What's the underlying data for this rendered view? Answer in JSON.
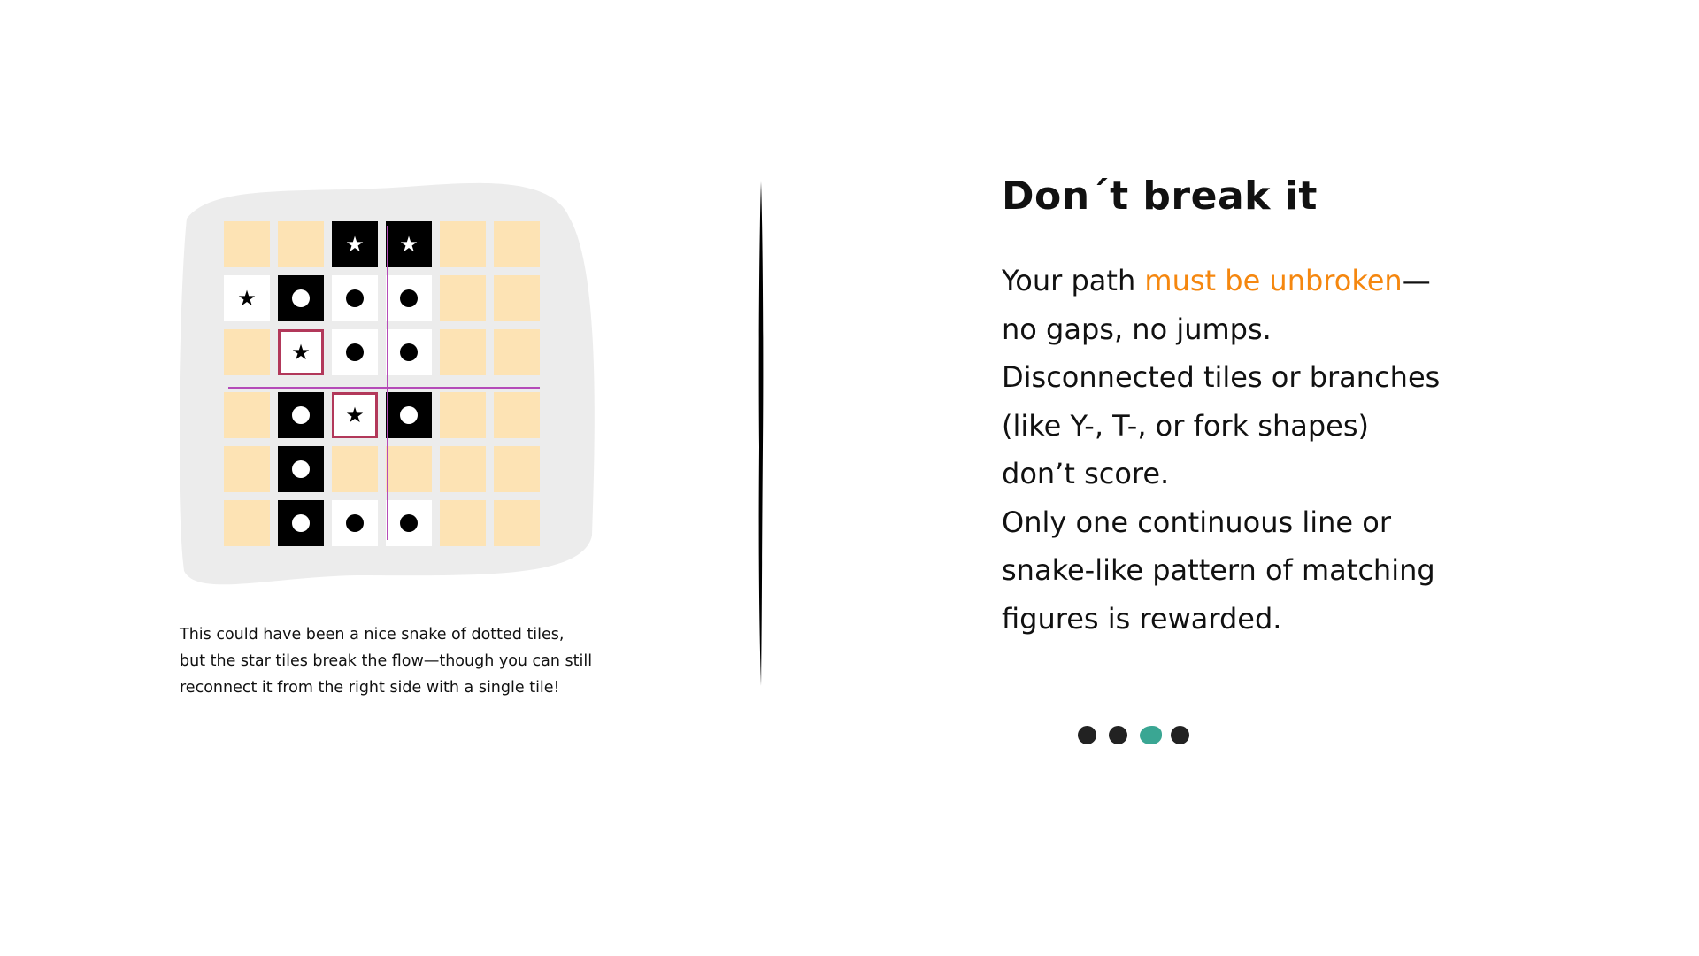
{
  "illustration": {
    "grid": [
      [
        "empty",
        "empty",
        "dark-star",
        "dark-star",
        "empty",
        "empty"
      ],
      [
        "light-star",
        "dark-dot",
        "light-dot",
        "light-dot",
        "empty",
        "empty"
      ],
      [
        "empty",
        "outlined-star",
        "light-dot",
        "light-dot",
        "empty",
        "empty"
      ],
      [
        "empty",
        "dark-dot",
        "outlined-star",
        "dark-dot",
        "empty",
        "empty"
      ],
      [
        "empty",
        "dark-dot",
        "empty",
        "empty",
        "empty",
        "empty"
      ],
      [
        "empty",
        "dark-dot",
        "light-dot",
        "light-dot",
        "empty",
        "empty"
      ]
    ],
    "star_glyph": "★",
    "caption_lines": [
      "This could have been a nice snake of dotted tiles,",
      "but the star tiles break the flow—though you can still",
      "reconnect it from the right side with a single tile!"
    ]
  },
  "content": {
    "title": "Don´t break it",
    "body_intro": "Your path ",
    "body_highlight": "must be unbroken",
    "body_rest": "—no gaps, no jumps. Disconnected tiles or branches (like Y-, T-, or fork shapes) don’t score.",
    "body_second": "Only one continuous line or snake-like pattern of matching figures is rewarded."
  },
  "pager": {
    "total": 4,
    "active_index": 2
  },
  "colors": {
    "empty_tile": "#fde3b4",
    "dark_tile": "#000000",
    "outline": "#b2385a",
    "guide_lines": "#b54bb8",
    "highlight": "#f5870f",
    "dot_inactive": "#222222",
    "dot_active": "#3aa693",
    "blob": "#ececec"
  }
}
